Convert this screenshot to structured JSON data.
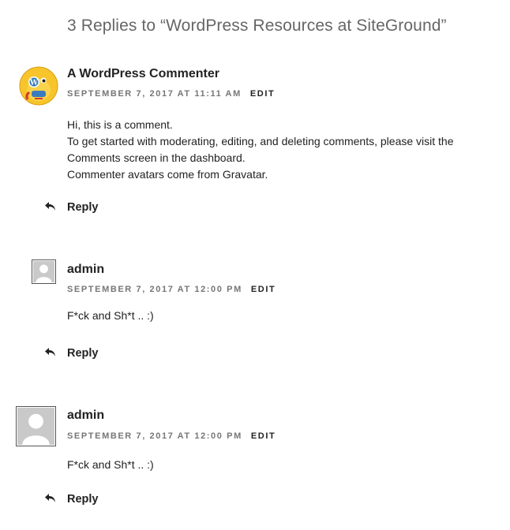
{
  "comments_title": "3 Replies to “WordPress Resources at SiteGround”",
  "comments": [
    {
      "author": "A WordPress Commenter",
      "date": "SEPTEMBER 7, 2017 AT 11:11 AM",
      "edit_label": "EDIT",
      "content_lines": [
        "Hi, this is a comment.",
        "To get started with moderating, editing, and deleting comments, please visit the",
        "Comments screen in the dashboard.",
        "Commenter avatars come from Gravatar."
      ],
      "reply_label": "Reply",
      "avatar_icon": "wapuu-avatar-icon"
    },
    {
      "author": "admin",
      "date": "SEPTEMBER 7, 2017 AT 12:00 PM",
      "edit_label": "EDIT",
      "content_lines": [
        "F*ck and Sh*t .. :)"
      ],
      "reply_label": "Reply",
      "avatar_icon": "default-user-avatar-icon"
    },
    {
      "author": "admin",
      "date": "SEPTEMBER 7, 2017 AT 12:00 PM",
      "edit_label": "EDIT",
      "content_lines": [
        "F*ck and Sh*t .. :)"
      ],
      "reply_label": "Reply",
      "avatar_icon": "default-user-avatar-icon"
    }
  ],
  "icons": {
    "reply": "reply-arrow-icon"
  },
  "colors": {
    "meta": "#767676",
    "text": "#222222",
    "title": "#666666",
    "avatar_bg": "#c9c9c9"
  }
}
